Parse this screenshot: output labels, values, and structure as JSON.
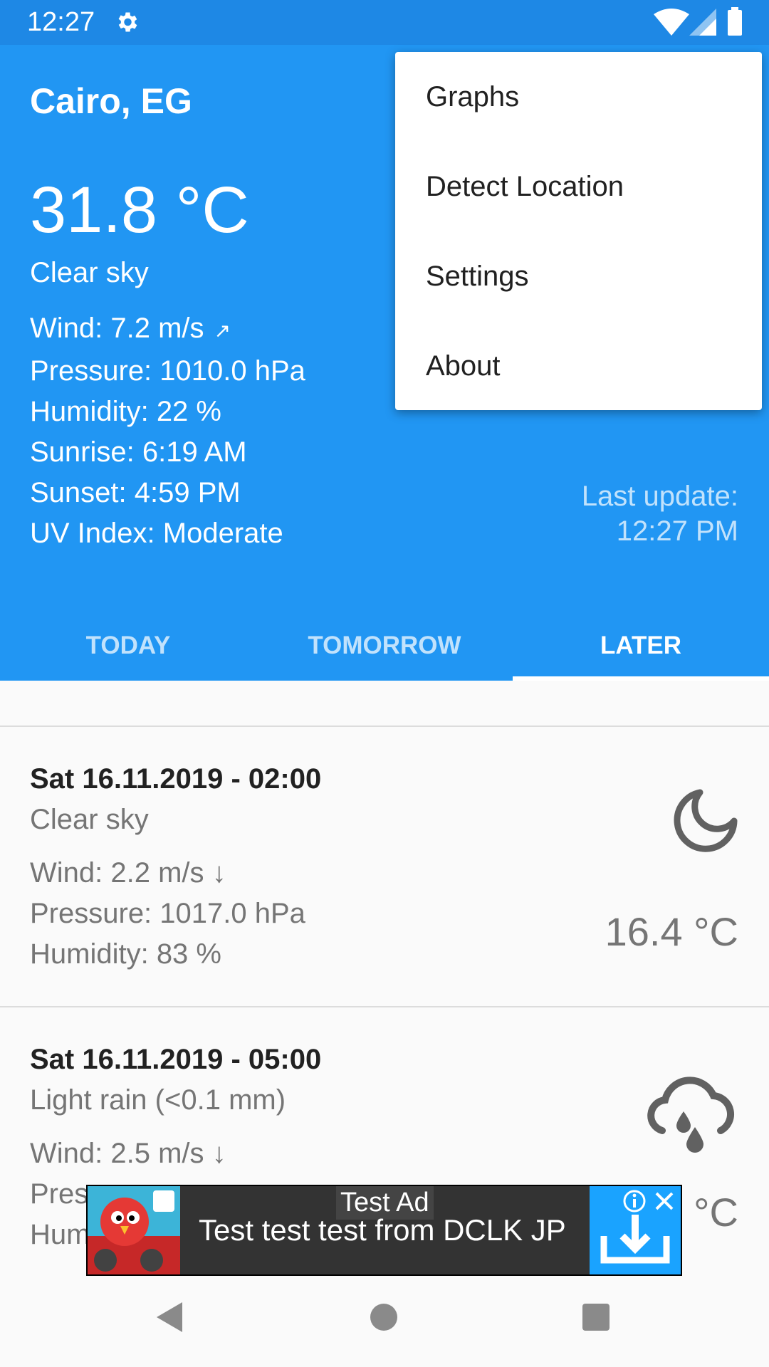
{
  "status_bar": {
    "time": "12:27",
    "icons": [
      "gear-icon",
      "wifi-icon",
      "cell-signal-icon",
      "battery-icon"
    ]
  },
  "current": {
    "city": "Cairo, EG",
    "temperature": "31.8 °C",
    "condition": "Clear sky",
    "wind": "Wind: 7.2 m/s",
    "wind_arrow": "↗",
    "pressure": "Pressure: 1010.0 hPa",
    "humidity": "Humidity: 22 %",
    "sunrise": "Sunrise: 6:19 AM",
    "sunset": "Sunset: 4:59 PM",
    "uv": "UV Index: Moderate",
    "last_update_label": "Last update:",
    "last_update_time": "12:27 PM"
  },
  "tabs": [
    {
      "label": "TODAY",
      "active": false
    },
    {
      "label": "TOMORROW",
      "active": false
    },
    {
      "label": "LATER",
      "active": true
    }
  ],
  "menu": {
    "items": [
      "Graphs",
      "Detect Location",
      "Settings",
      "About"
    ]
  },
  "forecast": [
    {
      "date": "Sat 16.11.2019 - 02:00",
      "condition": "Clear sky",
      "wind": "Wind: 2.2 m/s ↓",
      "pressure": "Pressure: 1017.0 hPa",
      "humidity": "Humidity: 83 %",
      "temperature": "16.4 °C",
      "icon": "moon-icon"
    },
    {
      "date": "Sat 16.11.2019 - 05:00",
      "condition": "Light rain (<0.1 mm)",
      "wind": "Wind: 2.5 m/s ↓",
      "pressure_partial": "Pres",
      "humidity_partial": "Hum",
      "temperature_partial": "°C",
      "icon": "rain-cloud-icon"
    }
  ],
  "ad": {
    "label": "Test Ad",
    "text": "Test test test from DCLK JP"
  },
  "colors": {
    "primary": "#2196f3",
    "status_bar": "#1e88e5",
    "background": "#fafafa"
  }
}
